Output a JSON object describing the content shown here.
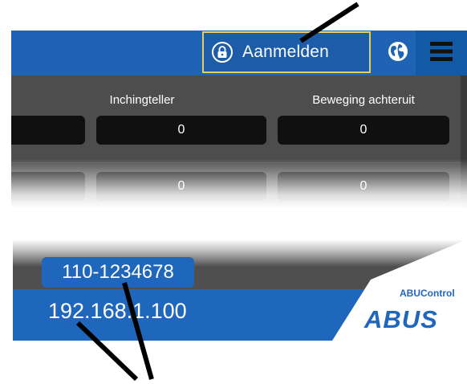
{
  "header": {
    "login_label": "Aanmelden",
    "lock_icon": "lock-icon",
    "globe_icon": "globe-icon",
    "menu_icon": "hamburger-menu-icon"
  },
  "table": {
    "columns": [
      "Inchingteller",
      "Beweging achteruit"
    ],
    "rows": [
      [
        "0",
        "0"
      ],
      [
        "0",
        "0"
      ]
    ]
  },
  "footer": {
    "serial": "110-1234678",
    "ip": "192.168.1.100",
    "brand_small": "ABUControl",
    "brand_big": "ABUS"
  },
  "colors": {
    "header_blue": "#1e63b4",
    "panel_gray": "#4d4d4d",
    "field_black": "#101010",
    "login_border": "#e2cf6a"
  }
}
